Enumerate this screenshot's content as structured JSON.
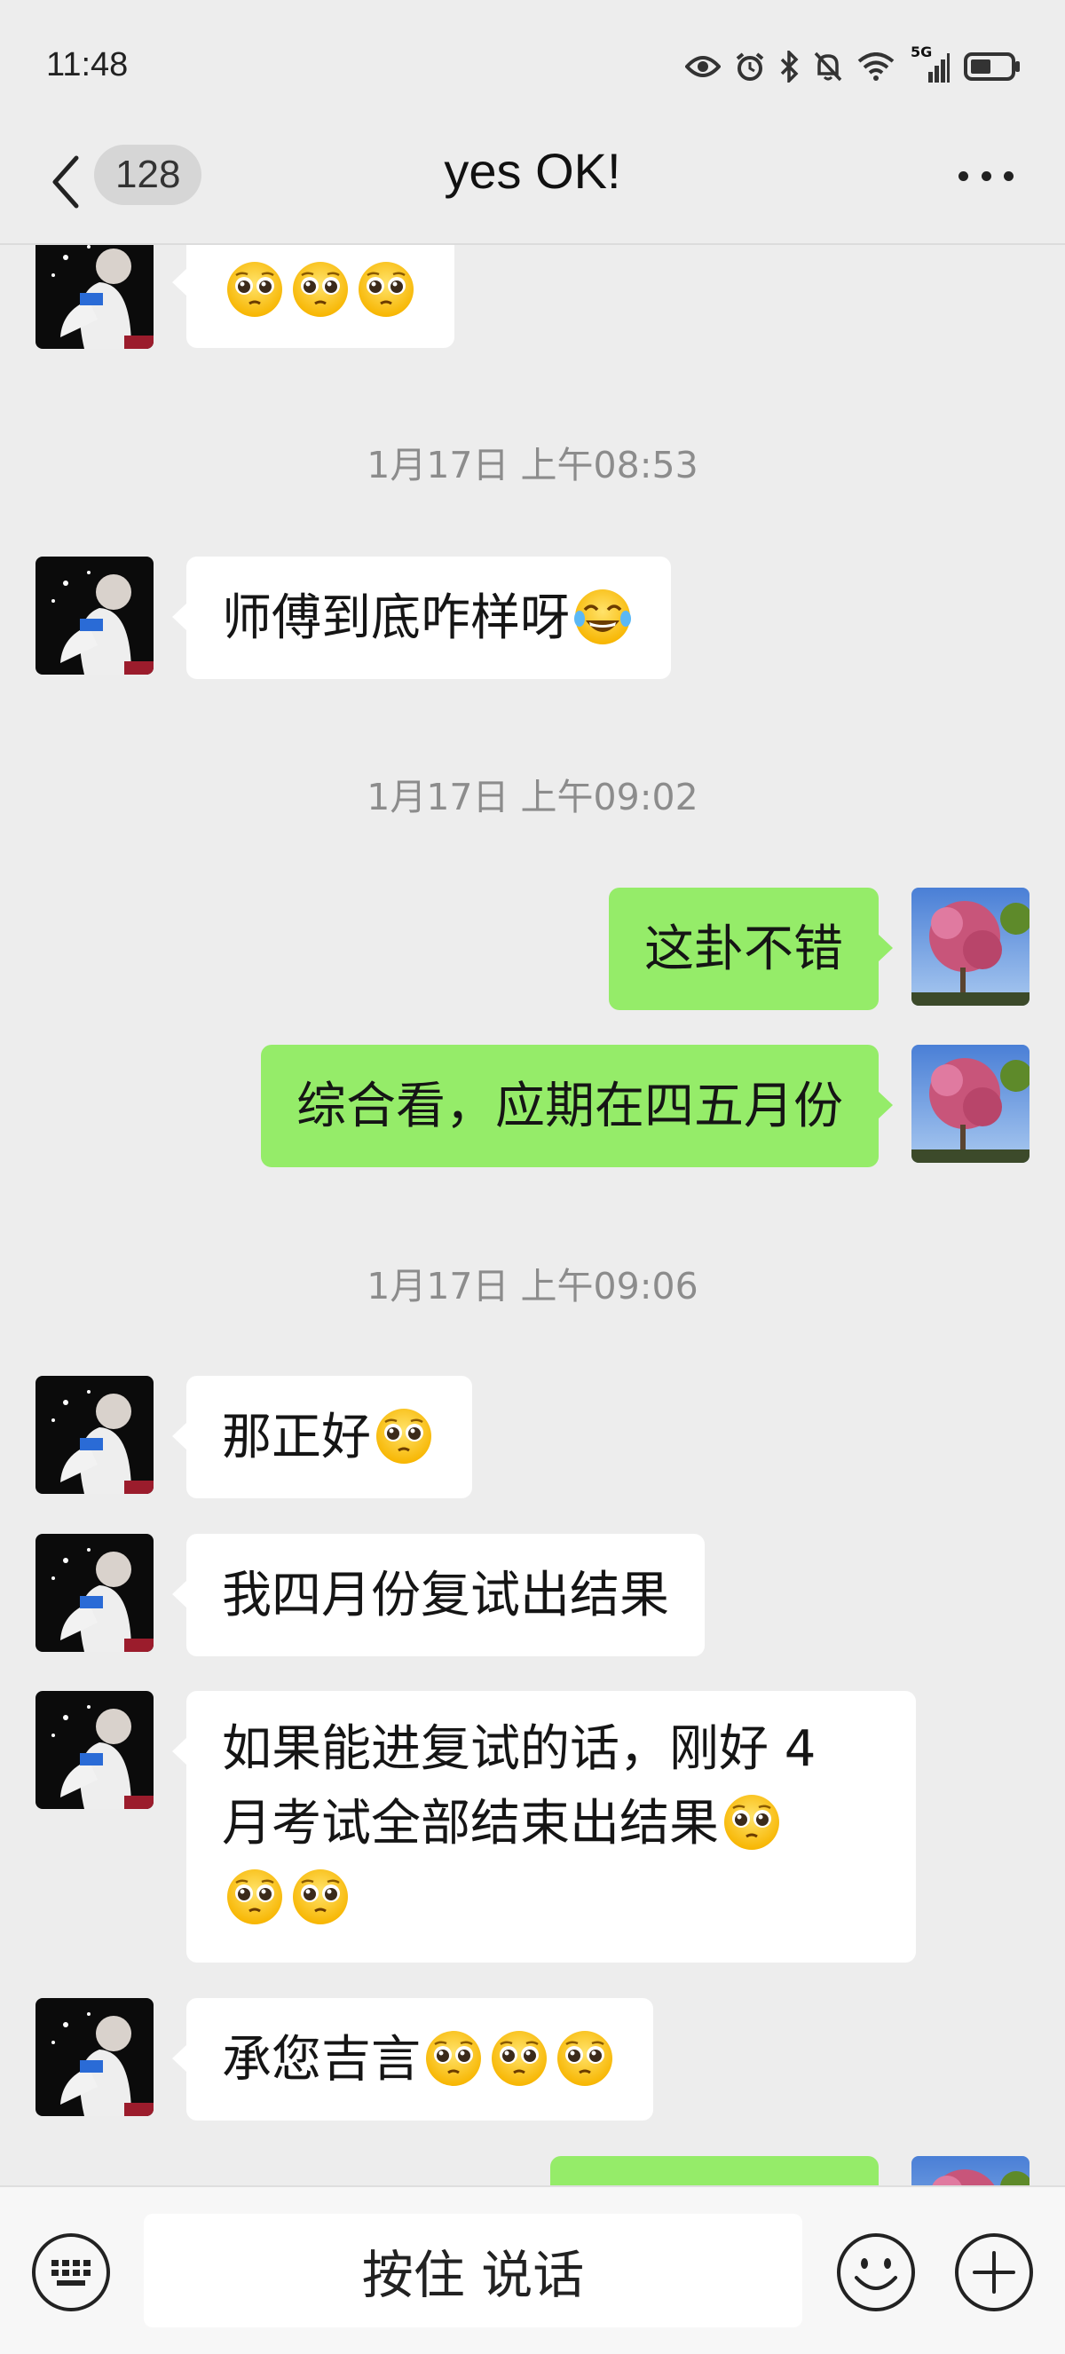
{
  "status_bar": {
    "time": "11:48",
    "network_label": "5G",
    "icons": [
      "eye-icon",
      "alarm-icon",
      "bluetooth-icon",
      "mute-icon",
      "wifi-icon",
      "signal-icon",
      "battery-icon"
    ]
  },
  "header": {
    "back_icon": "chevron-left-icon",
    "unread_count": "128",
    "title": "yes OK!",
    "more_icon": "more-dots-icon"
  },
  "colors": {
    "background": "#ededed",
    "sent_bubble": "#95ec69",
    "received_bubble": "#ffffff",
    "timestamp": "#8c8c8c"
  },
  "messages": [
    {
      "type": "received",
      "text": "",
      "emoji_after": 3
    },
    {
      "type": "timestamp",
      "text": "1月17日 上午08:53"
    },
    {
      "type": "received",
      "text": "师傅到底咋样呀",
      "emoji": "laughing-tears"
    },
    {
      "type": "timestamp",
      "text": "1月17日 上午09:02"
    },
    {
      "type": "sent",
      "text": "这卦不错"
    },
    {
      "type": "sent",
      "text": "综合看，应期在四五月份"
    },
    {
      "type": "timestamp",
      "text": "1月17日 上午09:06"
    },
    {
      "type": "received",
      "text": "那正好",
      "emoji_after": 1
    },
    {
      "type": "received",
      "text": "我四月份复试出结果"
    },
    {
      "type": "received",
      "line1": "如果能进复试的话，刚好 4",
      "line2": "月考试全部结束出结果",
      "emoji_after": 3
    },
    {
      "type": "received",
      "text": "承您吉言",
      "emoji_after": 3
    }
  ],
  "input_bar": {
    "keyboard_icon": "keyboard-icon",
    "hold_to_talk": "按住 说话",
    "emoji_icon": "smiley-icon",
    "plus_icon": "plus-icon"
  }
}
